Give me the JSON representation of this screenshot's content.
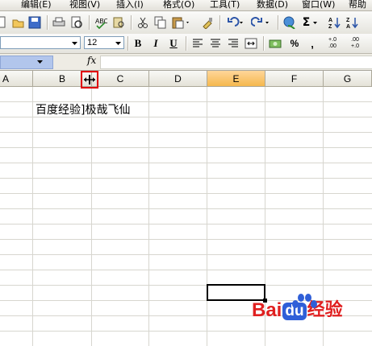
{
  "menu": {
    "items": [
      "编辑(E)",
      "视图(V)",
      "插入(I)",
      "格式(O)",
      "工具(T)",
      "数据(D)",
      "窗口(W)",
      "帮助"
    ]
  },
  "toolbar_standard": {
    "buttons": [
      "new-icon",
      "open-icon",
      "save-icon",
      "permission-icon",
      "print-icon",
      "print-preview-icon",
      "spelling-icon",
      "research-icon",
      "cut-icon",
      "copy-icon",
      "paste-icon",
      "format-painter-icon",
      "undo-icon",
      "redo-icon",
      "hyperlink-icon",
      "autosum-icon",
      "sort-ascending-icon",
      "sort-descending-icon"
    ],
    "autosum_glyph": "Σ"
  },
  "toolbar_formatting": {
    "font_size": "12",
    "bold_label": "B",
    "italic_label": "I",
    "underline_label": "U",
    "percent_label": "%",
    "comma_label": ",",
    "increase_decimal_label": "+.0 .00",
    "decrease_decimal_label": ".00 +.0"
  },
  "formula_bar": {
    "fx_label": "fx",
    "name_box_value": "",
    "formula_value": ""
  },
  "grid": {
    "columns": [
      "A",
      "B",
      "C",
      "D",
      "E",
      "F",
      "G"
    ],
    "active_column": "E",
    "cell_text": "百度经验]极哉飞仙"
  },
  "watermark": {
    "bai": "Bai",
    "du": "du",
    "jingyan": "经验",
    "colors": {
      "red": "#e02020",
      "blue": "#2f5fd8"
    }
  }
}
